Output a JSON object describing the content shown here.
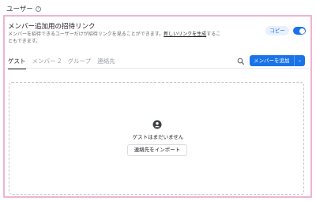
{
  "header": {
    "title": "ユーザー",
    "help_icon": "help-circle-icon"
  },
  "invite": {
    "title": "メンバー追加用の招待リンク",
    "description_pre": "メンバーを招待できるユーザーだけが招待リンクを見ることができます。",
    "link_text": "新しいリンクを生成",
    "description_post": "することもできます。",
    "copy_label": "コピー",
    "toggle_on": true
  },
  "tabs": [
    {
      "label": "ゲスト",
      "active": true
    },
    {
      "label": "メンバー 2",
      "active": false
    },
    {
      "label": "グループ",
      "active": false
    },
    {
      "label": "連絡先",
      "active": false
    }
  ],
  "toolbar": {
    "search_icon": "search-icon",
    "add_label": "メンバーを追加",
    "add_chevron": "⌄"
  },
  "empty_state": {
    "icon": "person-add-icon",
    "message": "ゲストはまだいません",
    "import_label": "連絡先をインポート"
  },
  "colors": {
    "accent": "#1a73e8",
    "highlight_border": "#f0b3d2"
  }
}
